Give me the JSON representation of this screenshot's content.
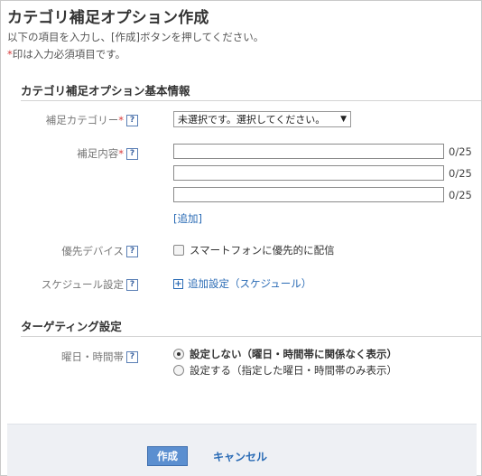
{
  "page": {
    "title": "カテゴリ補足オプション作成",
    "desc_line1": "以下の項目を入力し、[作成]ボタンを押してください。",
    "desc_req_mark": "*",
    "desc_line2": "印は入力必須項目です。"
  },
  "sections": {
    "basic": "カテゴリ補足オプション基本情報",
    "targeting": "ターゲティング設定"
  },
  "fields": {
    "category": {
      "label": "補足カテゴリー",
      "req": "*",
      "help": "?",
      "selected": "未選択です。選択してください。",
      "arrow": "▼"
    },
    "content": {
      "label": "補足内容",
      "req": "*",
      "help": "?",
      "inputs": [
        {
          "value": "",
          "counter": "0/25"
        },
        {
          "value": "",
          "counter": "0/25"
        },
        {
          "value": "",
          "counter": "0/25"
        }
      ],
      "add_link": "[追加]"
    },
    "device": {
      "label": "優先デバイス",
      "help": "?",
      "checkbox_label": "スマートフォンに優先的に配信",
      "checked": false
    },
    "schedule": {
      "label": "スケジュール設定",
      "help": "?",
      "plus": "+",
      "link": "追加設定（スケジュール）"
    },
    "daytime": {
      "label": "曜日・時間帯",
      "help": "?",
      "options": [
        {
          "label": "設定しない（曜日・時間帯に関係なく表示）",
          "selected": true
        },
        {
          "label": "設定する（指定した曜日・時間帯のみ表示）",
          "selected": false
        }
      ]
    }
  },
  "footer": {
    "submit": "作成",
    "cancel": "キャンセル"
  },
  "colors": {
    "accent": "#5b8fd0",
    "link": "#2a6bb5",
    "required": "#d83a3a"
  }
}
